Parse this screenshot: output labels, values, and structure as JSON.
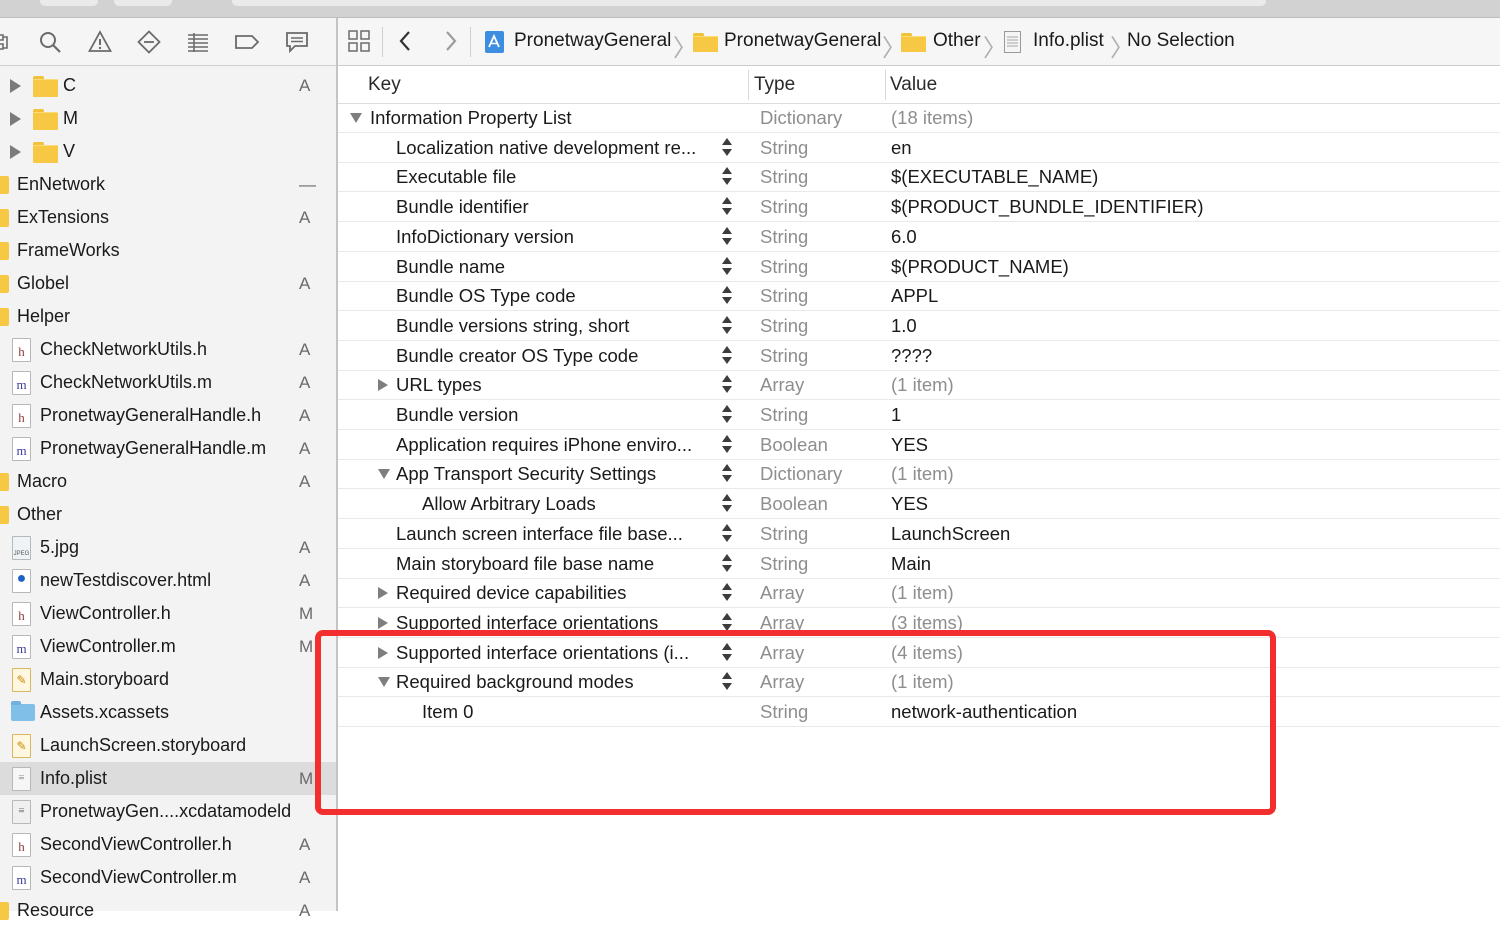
{
  "navigator_toolbar": {
    "icons": [
      "hierarchy-icon",
      "search-icon",
      "warning-icon",
      "test-icon",
      "debug-icon",
      "breakpoint-icon",
      "report-icon"
    ]
  },
  "sidebar": {
    "items": [
      {
        "name": "C",
        "kind": "folder",
        "status": "A",
        "disclosure": true
      },
      {
        "name": "M",
        "kind": "folder",
        "status": "",
        "disclosure": true
      },
      {
        "name": "V",
        "kind": "folder",
        "status": "",
        "disclosure": true
      },
      {
        "name": "EnNetwork",
        "kind": "group",
        "status": "—"
      },
      {
        "name": "ExTensions",
        "kind": "group",
        "status": "A"
      },
      {
        "name": "FrameWorks",
        "kind": "group",
        "status": ""
      },
      {
        "name": "Globel",
        "kind": "group",
        "status": "A"
      },
      {
        "name": "Helper",
        "kind": "group",
        "status": ""
      },
      {
        "name": "CheckNetworkUtils.h",
        "kind": "h",
        "status": "A"
      },
      {
        "name": "CheckNetworkUtils.m",
        "kind": "m",
        "status": "A"
      },
      {
        "name": "PronetwayGeneralHandle.h",
        "kind": "h",
        "status": "A"
      },
      {
        "name": "PronetwayGeneralHandle.m",
        "kind": "m",
        "status": "A"
      },
      {
        "name": "Macro",
        "kind": "group",
        "status": "A"
      },
      {
        "name": "Other",
        "kind": "group",
        "status": ""
      },
      {
        "name": "5.jpg",
        "kind": "img",
        "status": "A"
      },
      {
        "name": "newTestdiscover.html",
        "kind": "html",
        "status": "A"
      },
      {
        "name": "ViewController.h",
        "kind": "h",
        "status": "M"
      },
      {
        "name": "ViewController.m",
        "kind": "m",
        "status": "M"
      },
      {
        "name": "Main.storyboard",
        "kind": "sb",
        "status": ""
      },
      {
        "name": "Assets.xcassets",
        "kind": "assets",
        "status": ""
      },
      {
        "name": "LaunchScreen.storyboard",
        "kind": "sb",
        "status": ""
      },
      {
        "name": "Info.plist",
        "kind": "plist",
        "status": "M",
        "selected": true
      },
      {
        "name": "PronetwayGen....xcdatamodeld",
        "kind": "xcd",
        "status": ""
      },
      {
        "name": "SecondViewController.h",
        "kind": "h",
        "status": "A"
      },
      {
        "name": "SecondViewController.m",
        "kind": "m",
        "status": "A"
      },
      {
        "name": "Resource",
        "kind": "group",
        "status": "A"
      }
    ]
  },
  "jump_bar": {
    "crumbs": [
      "PronetwayGeneral",
      "PronetwayGeneral",
      "Other",
      "Info.plist",
      "No Selection"
    ]
  },
  "editor": {
    "headers": {
      "key": "Key",
      "type": "Type",
      "value": "Value"
    },
    "rows": [
      {
        "key": "Information Property List",
        "type": "Dictionary",
        "value": "(18 items)",
        "level": 0,
        "disclosure": "open",
        "value_gray": true,
        "stepper": false
      },
      {
        "key": "Localization native development re...",
        "type": "String",
        "value": "en",
        "level": 1,
        "stepper": true
      },
      {
        "key": "Executable file",
        "type": "String",
        "value": "$(EXECUTABLE_NAME)",
        "level": 1,
        "stepper": true
      },
      {
        "key": "Bundle identifier",
        "type": "String",
        "value": "$(PRODUCT_BUNDLE_IDENTIFIER)",
        "level": 1,
        "stepper": true
      },
      {
        "key": "InfoDictionary version",
        "type": "String",
        "value": "6.0",
        "level": 1,
        "stepper": true
      },
      {
        "key": "Bundle name",
        "type": "String",
        "value": "$(PRODUCT_NAME)",
        "level": 1,
        "stepper": true
      },
      {
        "key": "Bundle OS Type code",
        "type": "String",
        "value": "APPL",
        "level": 1,
        "stepper": true
      },
      {
        "key": "Bundle versions string, short",
        "type": "String",
        "value": "1.0",
        "level": 1,
        "stepper": true
      },
      {
        "key": "Bundle creator OS Type code",
        "type": "String",
        "value": "????",
        "level": 1,
        "stepper": true
      },
      {
        "key": "URL types",
        "type": "Array",
        "value": "(1 item)",
        "level": 1,
        "disclosure": "closed",
        "value_gray": true,
        "stepper": true
      },
      {
        "key": "Bundle version",
        "type": "String",
        "value": "1",
        "level": 1,
        "stepper": true
      },
      {
        "key": "Application requires iPhone enviro...",
        "type": "Boolean",
        "value": "YES",
        "level": 1,
        "stepper": true
      },
      {
        "key": "App Transport Security Settings",
        "type": "Dictionary",
        "value": "(1 item)",
        "level": 1,
        "disclosure": "open",
        "value_gray": true,
        "stepper": true
      },
      {
        "key": "Allow Arbitrary Loads",
        "type": "Boolean",
        "value": "YES",
        "level": 2,
        "stepper": true
      },
      {
        "key": "Launch screen interface file base...",
        "type": "String",
        "value": "LaunchScreen",
        "level": 1,
        "stepper": true
      },
      {
        "key": "Main storyboard file base name",
        "type": "String",
        "value": "Main",
        "level": 1,
        "stepper": true
      },
      {
        "key": "Required device capabilities",
        "type": "Array",
        "value": "(1 item)",
        "level": 1,
        "disclosure": "closed",
        "value_gray": true,
        "stepper": true
      },
      {
        "key": "Supported interface orientations",
        "type": "Array",
        "value": "(3 items)",
        "level": 1,
        "disclosure": "closed",
        "value_gray": true,
        "stepper": true
      },
      {
        "key": "Supported interface orientations (i...",
        "type": "Array",
        "value": "(4 items)",
        "level": 1,
        "disclosure": "closed",
        "value_gray": true,
        "stepper": true
      },
      {
        "key": "Required background modes",
        "type": "Array",
        "value": "(1 item)",
        "level": 1,
        "disclosure": "open",
        "value_gray": true,
        "stepper": true
      },
      {
        "key": "Item 0",
        "type": "String",
        "value": "network-authentication",
        "level": 2,
        "stepper": false
      }
    ]
  },
  "annotation": {
    "color": "#f22e2e"
  }
}
